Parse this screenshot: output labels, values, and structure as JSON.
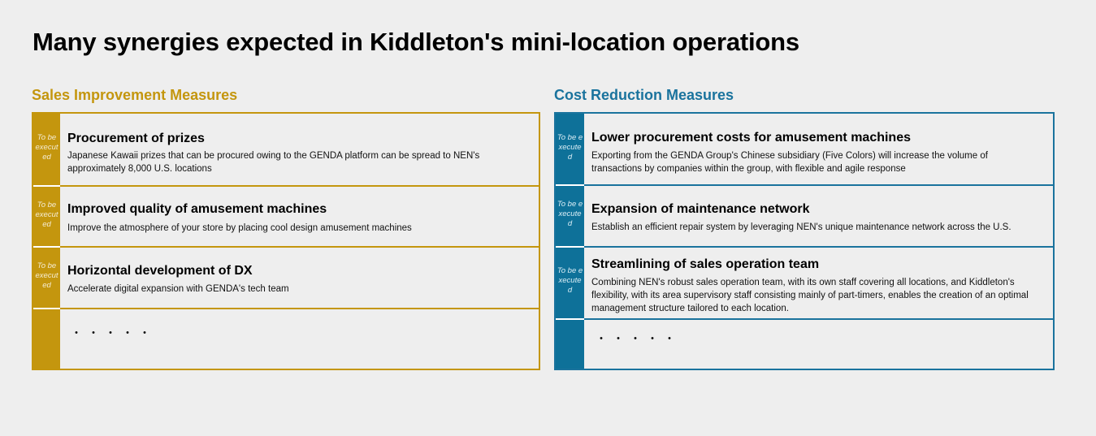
{
  "title": "Many synergies expected in Kiddleton's mini-location operations",
  "left": {
    "heading": "Sales Improvement Measures",
    "color": "#c4960e",
    "rows": [
      {
        "tag": "To be executed",
        "title": "Procurement of prizes",
        "desc": "Japanese Kawaii prizes that can be procured owing to the GENDA platform can be spread to NEN's approximately 8,000 U.S. locations"
      },
      {
        "tag": "To be executed",
        "title": "Improved quality of amusement machines",
        "desc": "Improve the atmosphere of your store by placing cool design amusement machines"
      },
      {
        "tag": "To be executed",
        "title": "Horizontal development of DX",
        "desc": "Accelerate digital expansion with GENDA's tech team"
      }
    ],
    "more": "・・・・・"
  },
  "right": {
    "heading": "Cost Reduction Measures",
    "color": "#1a739d",
    "rows": [
      {
        "tag": "To be executed",
        "title": "Lower procurement costs for amusement machines",
        "desc": "Exporting from the GENDA Group's Chinese subsidiary (Five Colors) will increase the volume of transactions by companies within the group, with flexible and agile response"
      },
      {
        "tag": "To be executed",
        "title": "Expansion of maintenance network",
        "desc": "Establish an efficient repair system by leveraging NEN's unique maintenance network across the U.S."
      },
      {
        "tag": "To be executed",
        "title": "Streamlining of sales operation team",
        "desc": "Combining NEN's robust sales operation team, with its own staff covering all locations, and Kiddleton's flexibility, with its area supervisory staff consisting mainly of part-timers, enables the creation of an optimal management structure tailored to each location."
      }
    ],
    "more": "・・・・・"
  }
}
